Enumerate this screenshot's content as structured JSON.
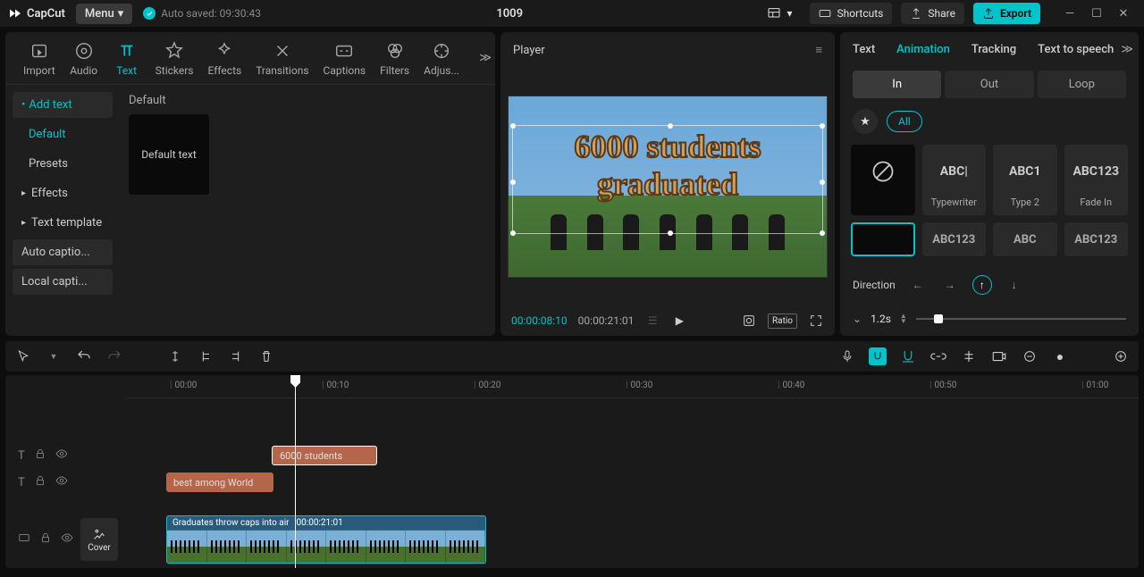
{
  "titlebar": {
    "app": "CapCut",
    "menu": "Menu",
    "autosave": "Auto saved: 09:30:43",
    "project": "1009",
    "shortcuts": "Shortcuts",
    "share": "Share",
    "export": "Export"
  },
  "topTabs": {
    "import": "Import",
    "audio": "Audio",
    "text": "Text",
    "stickers": "Stickers",
    "effects": "Effects",
    "transitions": "Transitions",
    "captions": "Captions",
    "filters": "Filters",
    "adjust": "Adjus..."
  },
  "sidebar": {
    "addText": "Add text",
    "default": "Default",
    "presets": "Presets",
    "effects": "Effects",
    "textTemplate": "Text template",
    "autoCaptions": "Auto captio...",
    "localCaptions": "Local capti..."
  },
  "content": {
    "heading": "Default",
    "thumb": "Default text"
  },
  "player": {
    "title": "Player",
    "overlay": "6000 students graduated",
    "curTime": "00:00:08:10",
    "durTime": "00:00:21:01",
    "ratio": "Ratio"
  },
  "rightTabs": {
    "text": "Text",
    "animation": "Animation",
    "tracking": "Tracking",
    "tts": "Text to speech"
  },
  "animTabs": {
    "in": "In",
    "out": "Out",
    "loop": "Loop"
  },
  "filter": {
    "all": "All"
  },
  "presets": {
    "typewriter": "Typewriter",
    "type2": "Type 2",
    "fadein": "Fade In",
    "p1": "ABC|",
    "p2": "ABC1",
    "p3": "ABC123",
    "r1": "ABC123",
    "r2": "ABC",
    "r3": "ABC123"
  },
  "direction": {
    "label": "Direction"
  },
  "duration": {
    "value": "1.2s"
  },
  "ruler": {
    "t0": "00:00",
    "t1": "00:10",
    "t2": "00:20",
    "t3": "00:30",
    "t4": "00:40",
    "t5": "00:50",
    "t6": "01:00"
  },
  "clips": {
    "text1": "6000 students",
    "text2": "best among World",
    "videoName": "Graduates throw caps into air",
    "videoDur": "00:00:21:01",
    "cover": "Cover"
  }
}
